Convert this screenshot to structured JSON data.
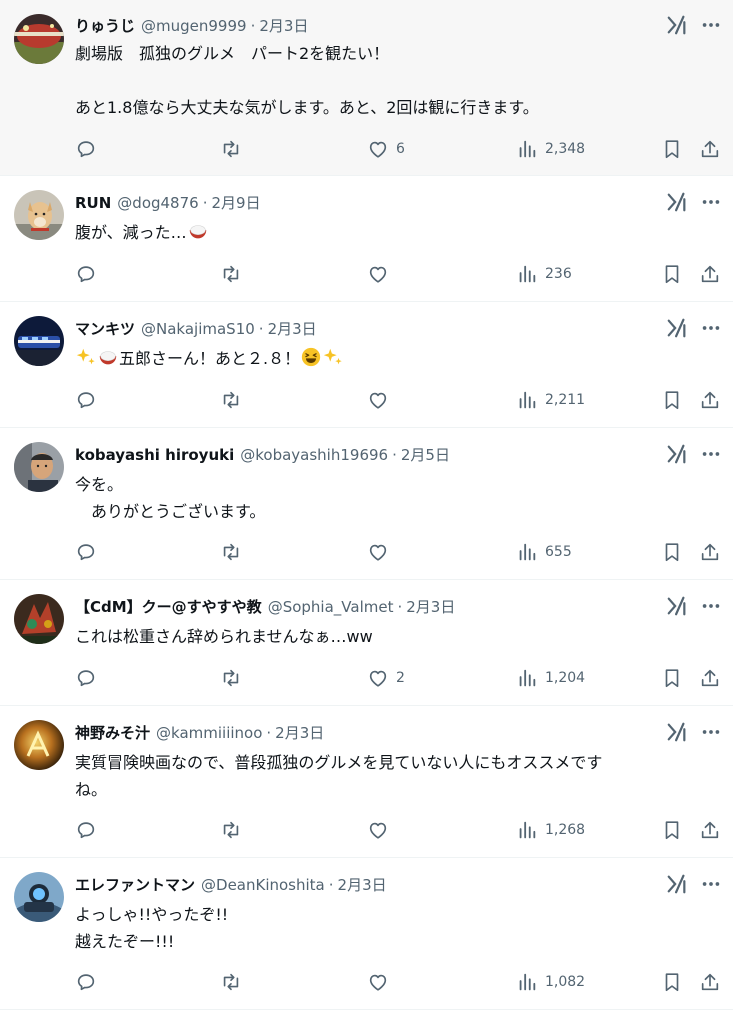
{
  "tweets": [
    {
      "name": "りゅうじ",
      "handle": "@mugen9999",
      "date": "2月3日",
      "lines": [
        "劇場版　孤独のグルメ　パート2を観たい！",
        "",
        "あと1.8億なら大丈夫な気がします。あと、2回は観に行きます。"
      ],
      "likes": "6",
      "views": "2,348"
    },
    {
      "name": "RUN",
      "handle": "@dog4876",
      "date": "2月9日",
      "lines": [
        "腹が、減った…"
      ],
      "likes": "",
      "views": "236"
    },
    {
      "name": "マンキツ",
      "handle": "@NakajimaS10",
      "date": "2月3日",
      "lines": [
        "五郎さーん！あと２.８！"
      ],
      "likes": "",
      "views": "2,211"
    },
    {
      "name": "kobayashi hiroyuki",
      "handle": "@kobayashih19696",
      "date": "2月5日",
      "lines": [
        "今を。",
        "　ありがとうございます。"
      ],
      "likes": "",
      "views": "655"
    },
    {
      "name": "【CdM】クー@すやすや教",
      "handle": "@Sophia_Valmet",
      "date": "2月3日",
      "lines": [
        "これは松重さん辞められませんなぁ…ww"
      ],
      "likes": "2",
      "views": "1,204"
    },
    {
      "name": "神野みそ汁",
      "handle": "@kammiiiinoo",
      "date": "2月3日",
      "lines": [
        "実質冒険映画なので、普段孤独のグルメを見ていない人にもオススメです",
        "ね。"
      ],
      "likes": "",
      "views": "1,268"
    },
    {
      "name": "エレファントマン",
      "handle": "@DeanKinoshita",
      "date": "2月3日",
      "lines": [
        "よっしゃ!!やったぞ!!",
        "越えたぞー!!!"
      ],
      "likes": "",
      "views": "1,082"
    }
  ],
  "colors": {
    "text": "#0f1419",
    "muted": "#536471",
    "highlight_bg": "#f7f7f7"
  },
  "icons": [
    "reply-icon",
    "retweet-icon",
    "like-icon",
    "views-icon",
    "bookmark-icon",
    "share-icon",
    "grok-icon",
    "more-icon"
  ]
}
